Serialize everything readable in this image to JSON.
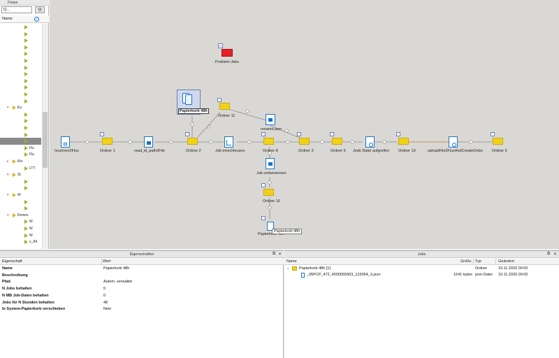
{
  "flows": {
    "title": "Flows",
    "search_placeholder": "Q...",
    "column_name": "Name",
    "items": [
      {
        "label": "",
        "kind": "flow"
      },
      {
        "label": "",
        "kind": "flow"
      },
      {
        "label": "",
        "kind": "flow"
      },
      {
        "label": "",
        "kind": "flow"
      },
      {
        "label": "",
        "kind": "flow"
      },
      {
        "label": "",
        "kind": "flow"
      },
      {
        "label": "",
        "kind": "flow"
      },
      {
        "label": "",
        "kind": "flow"
      },
      {
        "label": "",
        "kind": "flow"
      },
      {
        "label": "",
        "kind": "flow"
      },
      {
        "label": "",
        "kind": "flow"
      },
      {
        "label": "",
        "kind": "flow"
      },
      {
        "label": "Eu",
        "kind": "folder"
      },
      {
        "label": "",
        "kind": "flow"
      },
      {
        "label": "",
        "kind": "flow"
      },
      {
        "label": "",
        "kind": "flow"
      },
      {
        "label": "",
        "kind": "flow"
      },
      {
        "label": "",
        "kind": "flow"
      },
      {
        "label": "Flu",
        "kind": "flow"
      },
      {
        "label": "Flu",
        "kind": "flow"
      },
      {
        "label": "Kle",
        "kind": "folder"
      },
      {
        "label": "LTT",
        "kind": "flow"
      },
      {
        "label": "St",
        "kind": "folder"
      },
      {
        "label": "",
        "kind": "flow"
      },
      {
        "label": "",
        "kind": "flow"
      },
      {
        "label": "W",
        "kind": "folder"
      },
      {
        "label": "",
        "kind": "flow"
      },
      {
        "label": "",
        "kind": "flow"
      },
      {
        "label": "Komes",
        "kind": "folder"
      },
      {
        "label": "W",
        "kind": "flow"
      },
      {
        "label": "W",
        "kind": "flow"
      },
      {
        "label": "W",
        "kind": "flow"
      },
      {
        "label": "x_Alt",
        "kind": "flow"
      }
    ]
  },
  "canvas": {
    "nodes": {
      "problem_jobs": "Problem-Jobs",
      "papierkorb_top": "Papierkorb 48h",
      "ordner11": "Ordner 11",
      "rename_json": "rename json",
      "euchner2flux": "/euchner2Flux",
      "ordner1": "Ordner 1",
      "read_id_path2file": "read_id_path2File",
      "ordner2": "Ordner 2",
      "job_einschleusen": "Job einschleusen",
      "ordner8": "Ordner 8",
      "ordner3": "Ordner 3",
      "ordner9": "Ordner 9",
      "jede_datei": "Jede Datei aufgreifen",
      "ordner10": "Ordner 10",
      "upload_file": "uploadFile2FluxAndCreateOrder",
      "ordner5": "Ordner 5",
      "job_umbenennen": "Job umbenennen",
      "ordner16": "Ordner 16",
      "papierkorb_bottom": "Papierkorb 48h",
      "tooltip": "Papierkorb 48h"
    }
  },
  "properties": {
    "title": "Eigenschaften",
    "col_property": "Eigenschaft",
    "col_value": "Wert",
    "rows": [
      {
        "name": "Name",
        "value": "Papierkorb 48h"
      },
      {
        "name": "Beschreibung",
        "value": ""
      },
      {
        "name": "Pfad",
        "value": "Autom. verwaltet"
      },
      {
        "name": "N Jobs behalten",
        "value": "0"
      },
      {
        "name": "N MB Job-Daten behalten",
        "value": "0"
      },
      {
        "name": "Jobs für N Stunden behalten",
        "value": "48"
      },
      {
        "name": "In System-Papierkorb verschieben",
        "value": "Nein"
      }
    ]
  },
  "jobs": {
    "title": "Jobs",
    "col_name": "Name",
    "col_size": "Größe",
    "col_type": "Typ",
    "col_changed": "Geändert",
    "rows": [
      {
        "name": "Papierkorb 48h [1]",
        "size": "",
        "type": "Ordner",
        "changed": "19.11.2020 09:00"
      },
      {
        "name": "_05PCP_472_4500055903_123054_3.json",
        "size": "1541 bytes",
        "type": "json-Datei",
        "changed": "19.11.2020 09:00"
      }
    ]
  },
  "colors": {
    "folder_yellow": "#f1d21b",
    "flow_green": "#9ab22c",
    "problem_red": "#e8202a",
    "canvas_bg": "#d9d8d4",
    "highlight_blue": "#1a73c9",
    "orange_connector": "#f07b1e"
  }
}
